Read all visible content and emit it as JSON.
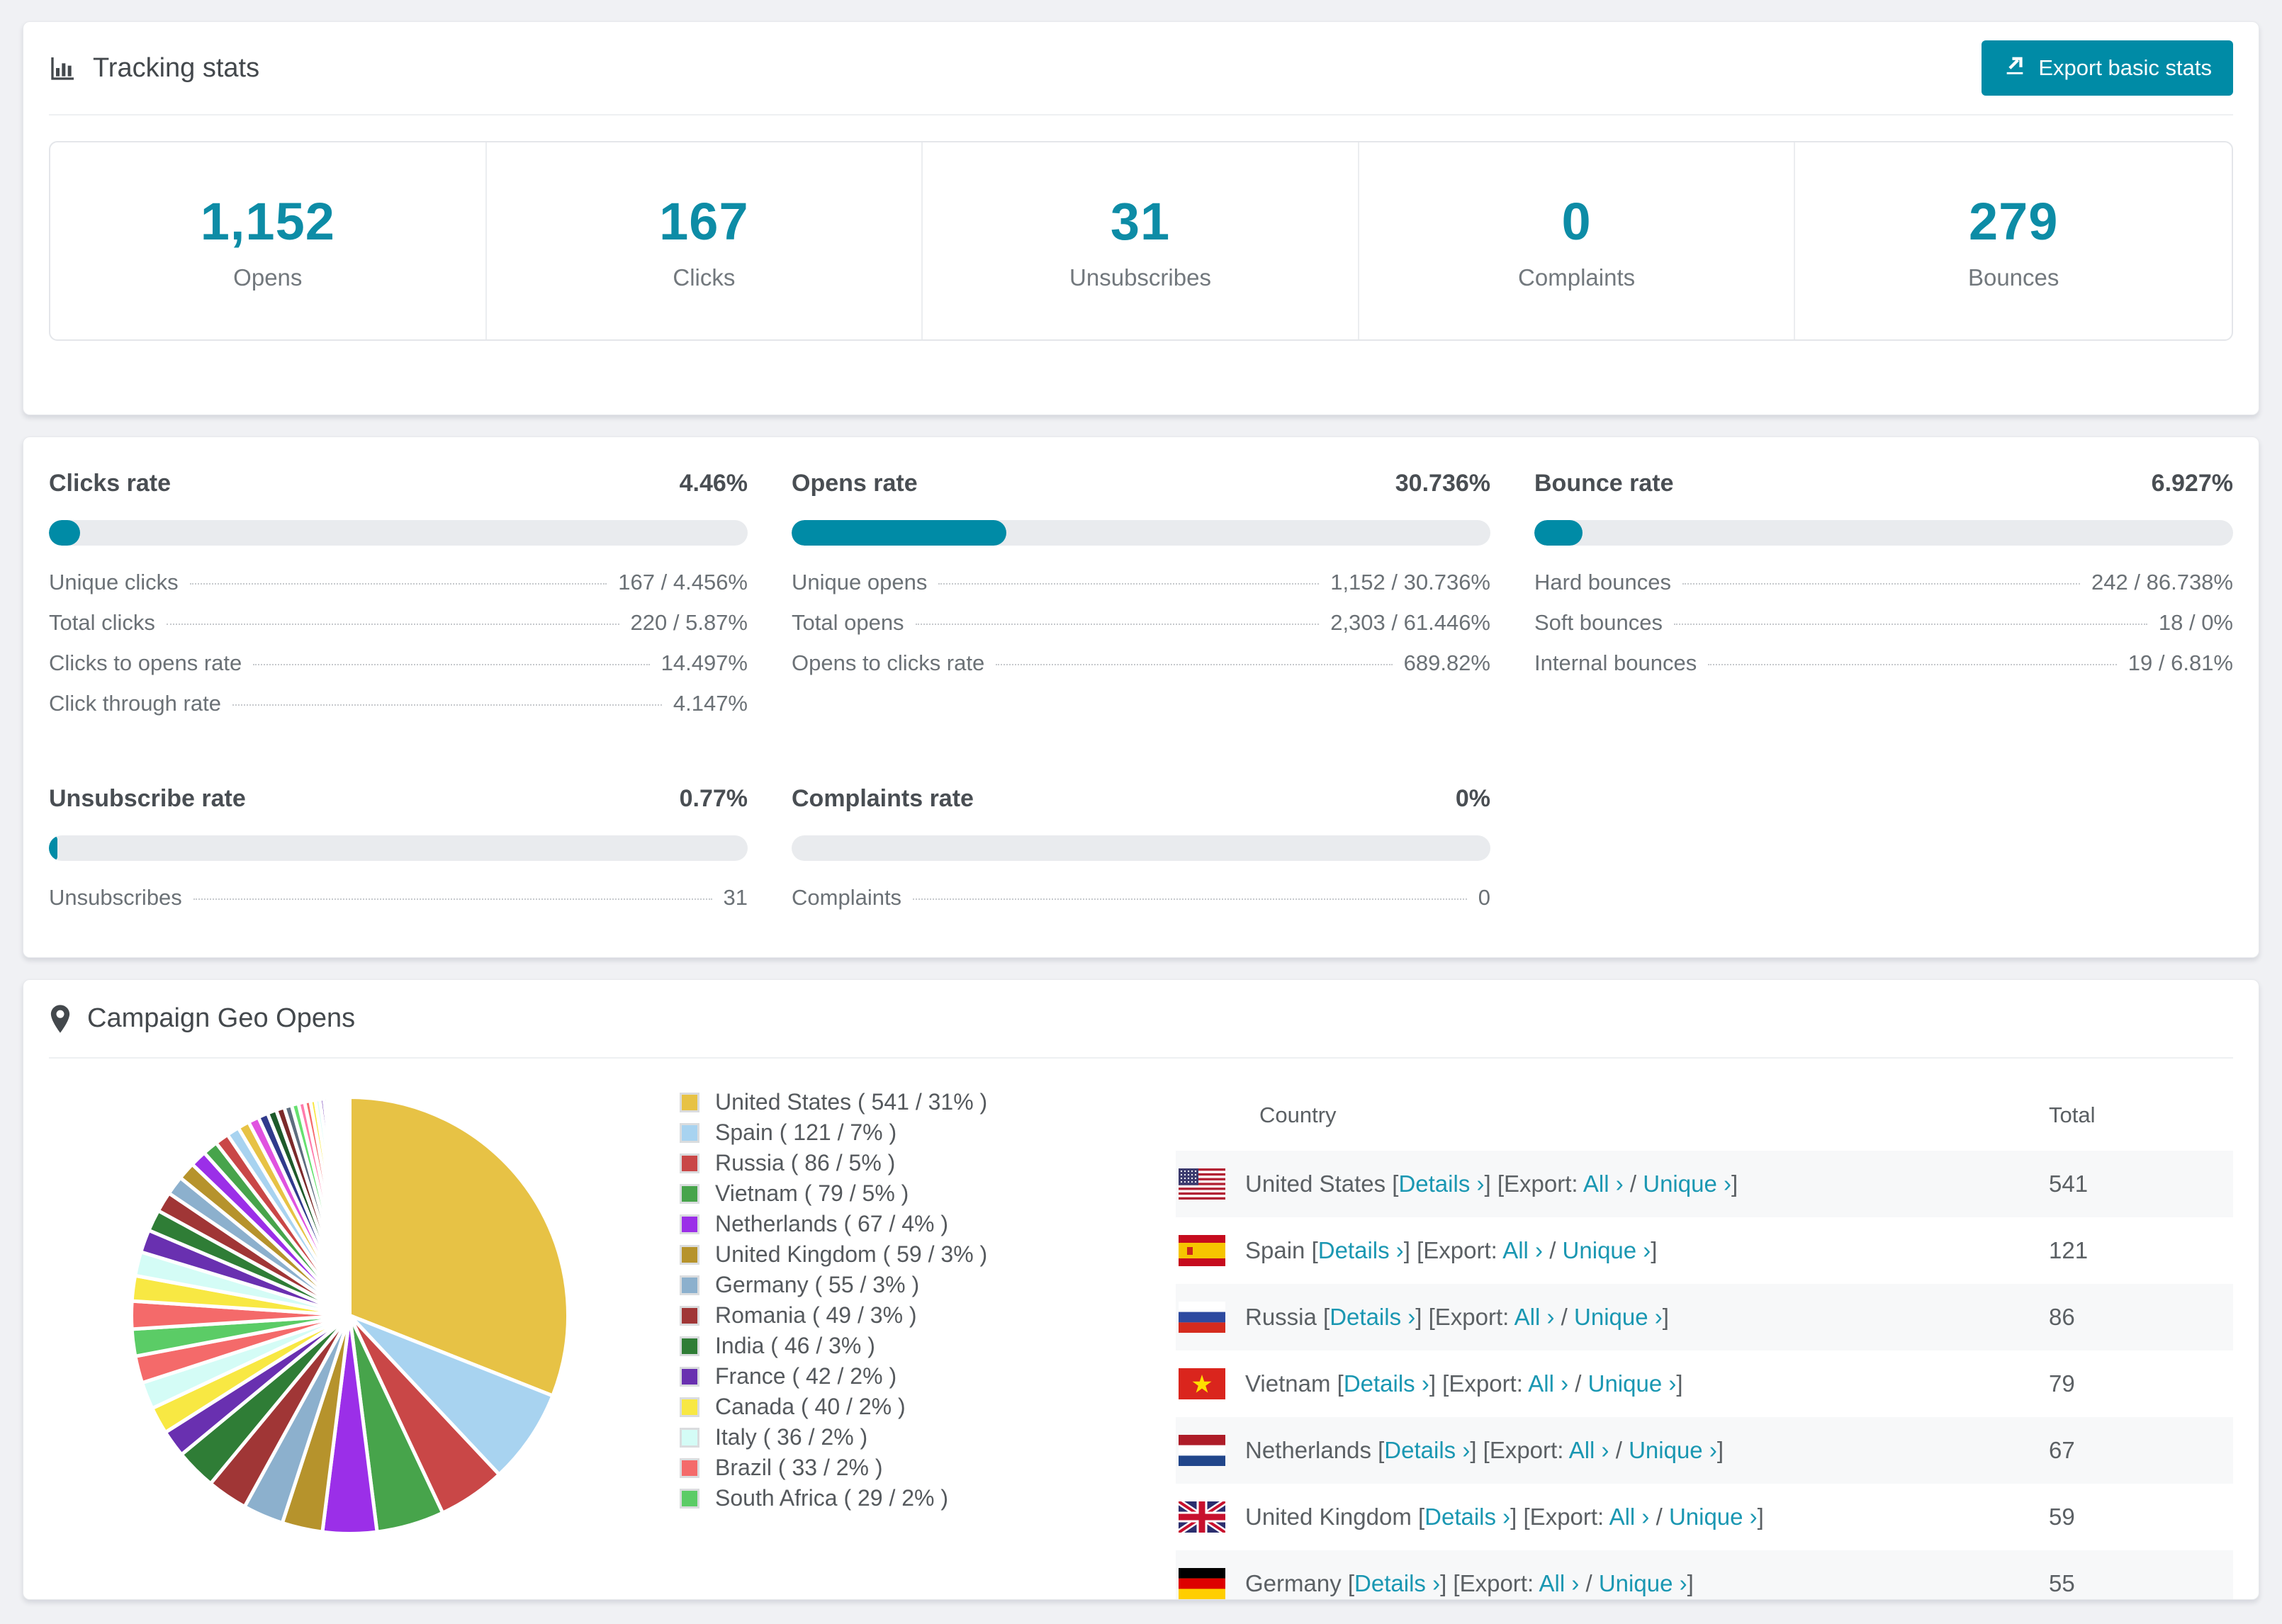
{
  "accent": "#008ba6",
  "tracking": {
    "title": "Tracking stats",
    "export_button": "Export basic stats"
  },
  "summary_stats": [
    {
      "value": "1,152",
      "label": "Opens"
    },
    {
      "value": "167",
      "label": "Clicks"
    },
    {
      "value": "31",
      "label": "Unsubscribes"
    },
    {
      "value": "0",
      "label": "Complaints"
    },
    {
      "value": "279",
      "label": "Bounces"
    }
  ],
  "rates": {
    "sections": [
      {
        "key": "clicks",
        "title": "Clicks rate",
        "pct_label": "4.46%",
        "bar_pct": 4.46,
        "rows": [
          [
            "Unique clicks",
            "167 / 4.456%"
          ],
          [
            "Total clicks",
            "220 / 5.87%"
          ],
          [
            "Clicks to opens rate",
            "14.497%"
          ],
          [
            "Click through rate",
            "4.147%"
          ]
        ]
      },
      {
        "key": "opens",
        "title": "Opens rate",
        "pct_label": "30.736%",
        "bar_pct": 30.736,
        "rows": [
          [
            "Unique opens",
            "1,152 / 30.736%"
          ],
          [
            "Total opens",
            "2,303 / 61.446%"
          ],
          [
            "Opens to clicks rate",
            "689.82%"
          ]
        ]
      },
      {
        "key": "bounces",
        "title": "Bounce rate",
        "pct_label": "6.927%",
        "bar_pct": 6.927,
        "rows": [
          [
            "Hard bounces",
            "242 / 86.738%"
          ],
          [
            "Soft bounces",
            "18 / 0%"
          ],
          [
            "Internal bounces",
            "19 / 6.81%"
          ]
        ]
      },
      {
        "key": "unsubscribe",
        "title": "Unsubscribe rate",
        "pct_label": "0.77%",
        "bar_pct": 0.77,
        "rows": [
          [
            "Unsubscribes",
            "31"
          ]
        ]
      },
      {
        "key": "complaints",
        "title": "Complaints rate",
        "pct_label": "0%",
        "bar_pct": 0,
        "rows": [
          [
            "Complaints",
            "0"
          ]
        ]
      }
    ]
  },
  "geo": {
    "title": "Campaign Geo Opens",
    "table": {
      "columns": [
        "Country",
        "Total"
      ],
      "fmt": {
        "lb": "[",
        "rb": "]",
        "details": "Details",
        "export": "Export:",
        "all": "All",
        "unique": "Unique",
        "slash": "/",
        "chevron": "›"
      },
      "rows": [
        {
          "country": "United States",
          "flag": "us",
          "total": "541"
        },
        {
          "country": "Spain",
          "flag": "es",
          "total": "121"
        },
        {
          "country": "Russia",
          "flag": "ru",
          "total": "86"
        },
        {
          "country": "Vietnam",
          "flag": "vn",
          "total": "79"
        },
        {
          "country": "Netherlands",
          "flag": "nl",
          "total": "67"
        },
        {
          "country": "United Kingdom",
          "flag": "gb",
          "total": "59"
        },
        {
          "country": "Germany",
          "flag": "de",
          "total": "55"
        }
      ]
    }
  },
  "chart_data": {
    "type": "pie",
    "title": "Campaign Geo Opens",
    "legend_fmt": "{name} ( {value} / {pct}% )",
    "slices": [
      {
        "label": "United States",
        "value": 541,
        "pct": 31,
        "color": "#e7c245"
      },
      {
        "label": "Spain",
        "value": 121,
        "pct": 7,
        "color": "#a8d3f0"
      },
      {
        "label": "Russia",
        "value": 86,
        "pct": 5,
        "color": "#c94747"
      },
      {
        "label": "Vietnam",
        "value": 79,
        "pct": 5,
        "color": "#47a44b"
      },
      {
        "label": "Netherlands",
        "value": 67,
        "pct": 4,
        "color": "#9b2fe8"
      },
      {
        "label": "United Kingdom",
        "value": 59,
        "pct": 3,
        "color": "#b6932c"
      },
      {
        "label": "Germany",
        "value": 55,
        "pct": 3,
        "color": "#8cb0cd"
      },
      {
        "label": "Romania",
        "value": 49,
        "pct": 3,
        "color": "#a03636"
      },
      {
        "label": "India",
        "value": 46,
        "pct": 3,
        "color": "#2f7d36"
      },
      {
        "label": "France",
        "value": 42,
        "pct": 2,
        "color": "#6930b0"
      },
      {
        "label": "Canada",
        "value": 40,
        "pct": 2,
        "color": "#f8e843"
      },
      {
        "label": "Italy",
        "value": 36,
        "pct": 2,
        "color": "#d4fcf6"
      },
      {
        "label": "Brazil",
        "value": 33,
        "pct": 2,
        "color": "#f46a6a"
      },
      {
        "label": "South Africa",
        "value": 29,
        "pct": 2,
        "color": "#5bcc66"
      }
    ],
    "other_weights": [
      2.2,
      2.0,
      1.9,
      1.8,
      1.7,
      1.6,
      1.5,
      1.4,
      1.3,
      1.2,
      1.1,
      1.0,
      0.92,
      0.85,
      0.78,
      0.72,
      0.66,
      0.6,
      0.55,
      0.5,
      0.45,
      0.4,
      0.36,
      0.32,
      0.28,
      0.25,
      0.22,
      0.19,
      0.17,
      0.15,
      0.13,
      0.11,
      0.1,
      0.09,
      0.08,
      0.07,
      0.06,
      0.05,
      0.04,
      0.03
    ],
    "other_colors": [
      "#f46a6a",
      "#f8e843",
      "#d4fcf6",
      "#6930b0",
      "#2f7d36",
      "#a03636",
      "#8cb0cd",
      "#b6932c",
      "#9b2fe8",
      "#47a44b",
      "#c94747",
      "#a8d3f0",
      "#e7c245",
      "#e052e0",
      "#303a8c",
      "#1e5a2a",
      "#7c2a2a",
      "#5d6d7e",
      "#66e06f",
      "#ff7bac"
    ]
  }
}
